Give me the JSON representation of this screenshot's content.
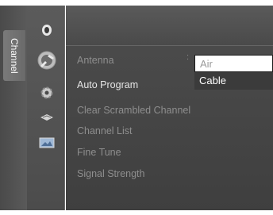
{
  "side_tab": {
    "label": "Channel"
  },
  "icons": [
    {
      "name": "picture-icon"
    },
    {
      "name": "channel-icon"
    },
    {
      "name": "setup-icon"
    },
    {
      "name": "input-icon"
    },
    {
      "name": "application-icon"
    }
  ],
  "menu": {
    "items": [
      {
        "label": "Antenna",
        "state": "dim"
      },
      {
        "label": "Auto Program",
        "state": "normal"
      },
      {
        "label": "Clear Scrambled Channel",
        "state": "dim"
      },
      {
        "label": "Channel List",
        "state": "dim"
      },
      {
        "label": "Fine Tune",
        "state": "dim"
      },
      {
        "label": "Signal Strength",
        "state": "dim"
      }
    ]
  },
  "popup": {
    "options": [
      {
        "label": "Air",
        "selected": true
      },
      {
        "label": "Cable",
        "selected": false
      }
    ]
  },
  "colors": {
    "panel": "#4d4d4d",
    "text": "#e6e6e6",
    "dim_text": "#8e8e8e",
    "popup_bg": "#ffffff"
  }
}
